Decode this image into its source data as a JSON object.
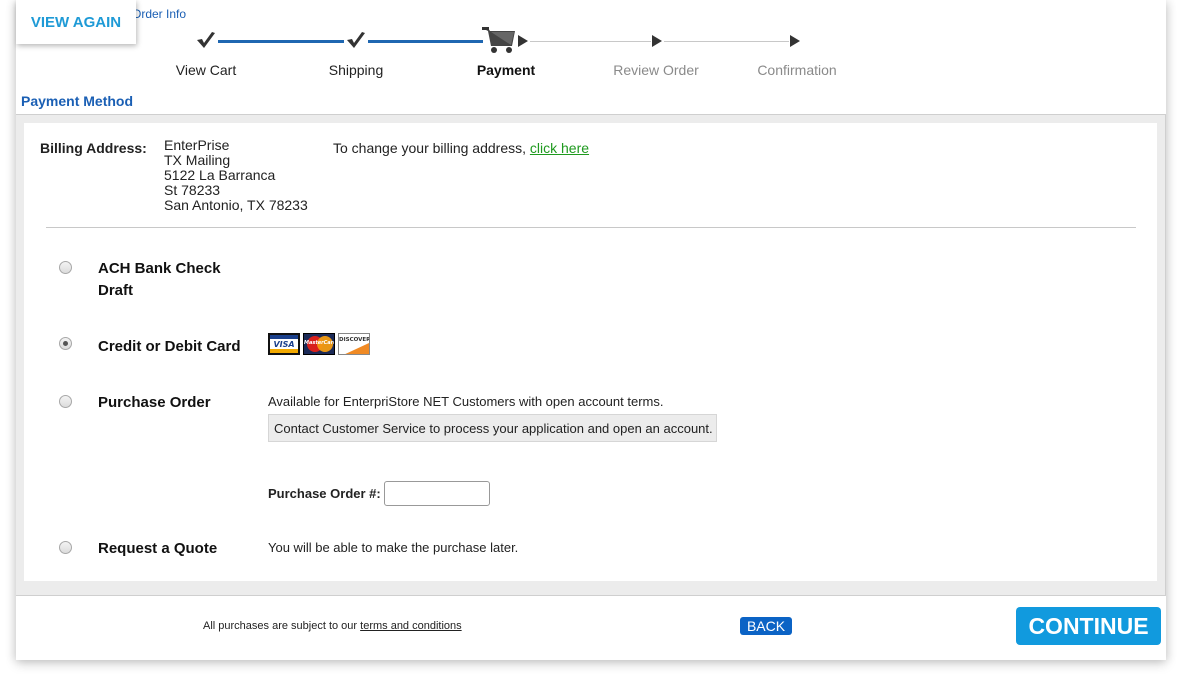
{
  "header": {
    "view_again_label": "VIEW AGAIN",
    "order_info_link": "Order Info"
  },
  "steps": [
    {
      "label": "View Cart",
      "status": "done",
      "icon": "checkmark-icon"
    },
    {
      "label": "Shipping",
      "status": "done",
      "icon": "checkmark-icon"
    },
    {
      "label": "Payment",
      "status": "current",
      "icon": "shopping-cart-icon"
    },
    {
      "label": "Review Order",
      "status": "future",
      "icon": "arrow-right-icon"
    },
    {
      "label": "Confirmation",
      "status": "future",
      "icon": "arrow-right-icon"
    }
  ],
  "colors": {
    "accent_blue": "#1f67b1",
    "title_blue": "#1a5fb4",
    "link_green": "#1f9a1f",
    "continue_blue": "#119ade",
    "back_blue": "#0b63c5"
  },
  "payment": {
    "section_title": "Payment Method",
    "billing": {
      "label": "Billing Address:",
      "lines": [
        "EnterPrise",
        "TX Mailing",
        "5122 La Barranca",
        "St 78233",
        "San Antonio, TX 78233"
      ],
      "change_text": "To change your billing address, ",
      "change_link": "click here"
    },
    "options": [
      {
        "label_line1": "ACH Bank Check",
        "label_line2": "Draft",
        "selected": false
      },
      {
        "label": "Credit or Debit Card",
        "selected": true,
        "cards": [
          "VISA",
          "MasterCard",
          "DISCOVER"
        ]
      },
      {
        "label": "Purchase Order",
        "selected": false,
        "description": "Available for EnterpriStore NET Customers with open account terms.",
        "note": "Contact Customer Service to process your application and open an account.",
        "field_label": "Purchase Order #:",
        "field_value": "",
        "field_placeholder": ""
      },
      {
        "label": "Request a Quote",
        "selected": false,
        "description": "You will be able to make the purchase later."
      }
    ]
  },
  "footer": {
    "terms_text": "All purchases are subject to our ",
    "terms_link": "terms and conditions",
    "back_label": "BACK",
    "continue_label": "CONTINUE"
  }
}
